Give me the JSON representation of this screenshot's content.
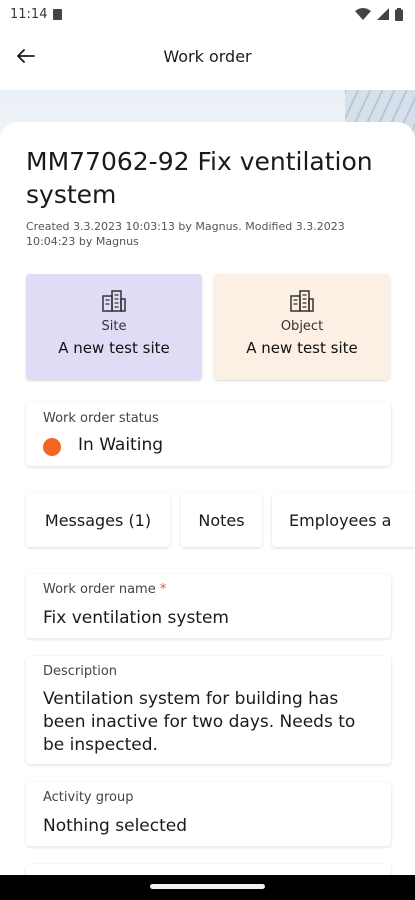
{
  "status_bar": {
    "time": "11:14"
  },
  "app_bar": {
    "title": "Work order",
    "back_icon": "arrow-left-icon"
  },
  "work_order": {
    "title": "MM77062-92 Fix ventilation system",
    "meta": "Created 3.3.2023 10:03:13 by Magnus. Modified 3.3.2023 10:04:23 by Magnus"
  },
  "tiles": {
    "site": {
      "label": "Site",
      "value": "A new test site",
      "icon": "building-icon",
      "color": "#e1dcf6"
    },
    "object": {
      "label": "Object",
      "value": "A new test site",
      "icon": "building-icon",
      "color": "#fcefe3"
    }
  },
  "status": {
    "label": "Work order status",
    "value": "In Waiting",
    "dot_color": "#f26522"
  },
  "tabs": [
    {
      "label": "Messages (1)"
    },
    {
      "label": "Notes"
    },
    {
      "label": "Employees a"
    }
  ],
  "fields": {
    "name": {
      "label": "Work order name",
      "required_mark": "*",
      "value": "Fix ventilation system"
    },
    "description": {
      "label": "Description",
      "value": "Ventilation system for building has been inactive for two days. Needs to be inspected."
    },
    "activity_group": {
      "label": "Activity group",
      "value": "Nothing selected"
    }
  }
}
